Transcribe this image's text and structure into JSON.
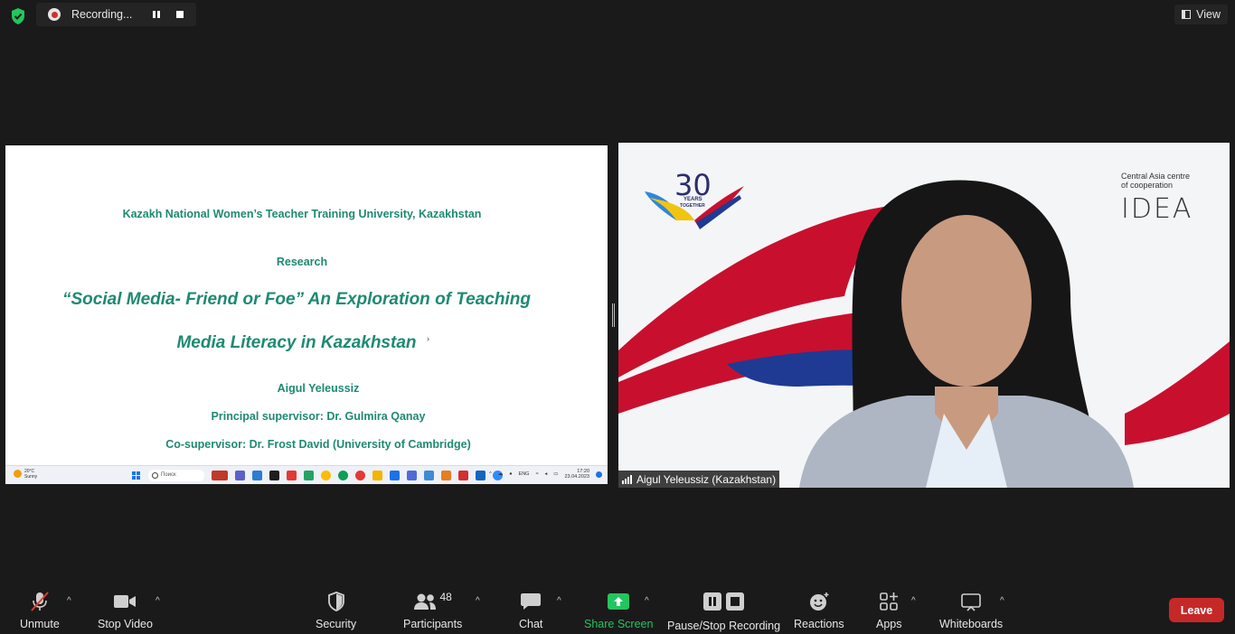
{
  "recording": {
    "status_label": "Recording..."
  },
  "top_right": {
    "view_label": "View"
  },
  "slide": {
    "university": "Kazakh National Women’s Teacher Training University, Kazakhstan",
    "kind": "Research",
    "title_line1": "“Social Media- Friend or Foe” An Exploration of Teaching",
    "title_line2": "Media Literacy in Kazakhstan",
    "author": "Aigul Yeleussiz",
    "supervisor": "Principal supervisor: Dr. Gulmira Qanay",
    "co_supervisor": "Co-supervisor: Dr. Frost David (University of Cambridge)",
    "taskbar": {
      "weather_temp": "20°C",
      "weather_cond": "Sunny",
      "search_placeholder": "Поиск",
      "language": "ENG",
      "time": "17:20",
      "date": "23.04.2023"
    }
  },
  "video_tile": {
    "participant_name": "Aigul Yeleussiz (Kazakhstan)",
    "badge_30_years": "YEARS",
    "badge_together": "TOGETHER",
    "org_caption_line1": "Central Asia centre",
    "org_caption_line2": "of cooperation",
    "org_logo": "IDEA"
  },
  "toolbar": {
    "unmute": "Unmute",
    "stop_video": "Stop Video",
    "security": "Security",
    "participants": "Participants",
    "participants_count": "48",
    "chat": "Chat",
    "share_screen": "Share Screen",
    "pause_stop_recording": "Pause/Stop Recording",
    "reactions": "Reactions",
    "apps": "Apps",
    "whiteboards": "Whiteboards",
    "leave": "Leave"
  },
  "colors": {
    "background": "#1a1a1a",
    "slide_text": "#1e8a72",
    "share_green": "#23c55e",
    "leave_red": "#c62828",
    "flag_red": "#c8102e",
    "flag_blue": "#1f3a93"
  }
}
